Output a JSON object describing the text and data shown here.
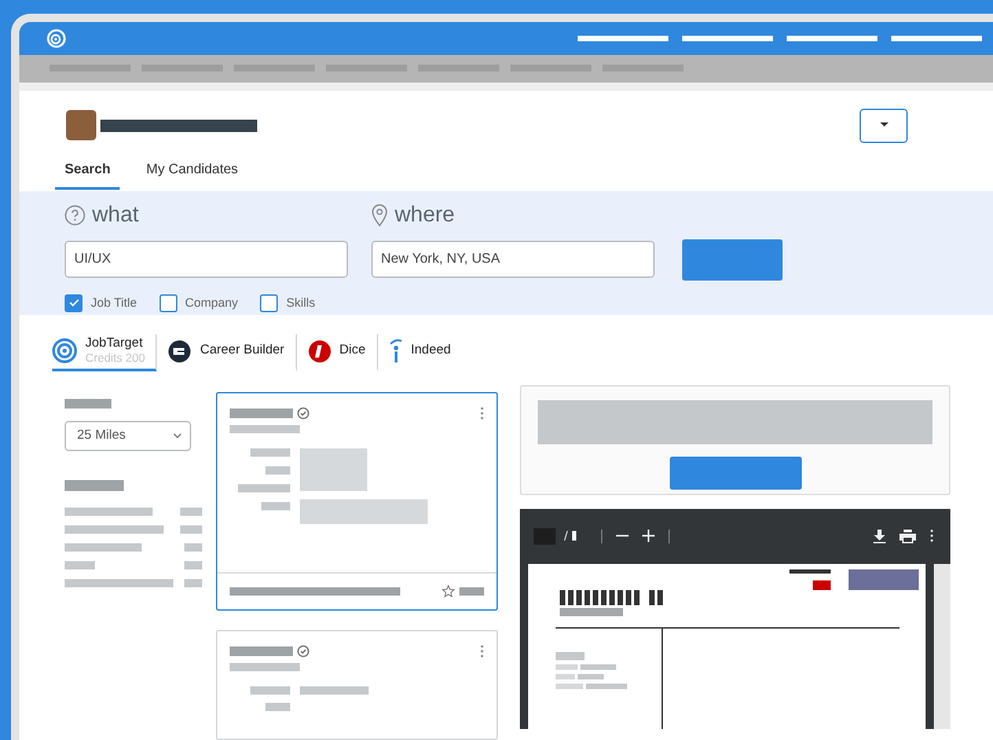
{
  "tabs": [
    {
      "label": "Search",
      "selected": true
    },
    {
      "label": "My Candidates",
      "selected": false
    }
  ],
  "search": {
    "what_label": "what",
    "where_label": "where",
    "what_value": "UI/UX",
    "where_value": "New York, NY, USA",
    "filters": [
      {
        "label": "Job Title",
        "checked": true
      },
      {
        "label": "Company",
        "checked": false
      },
      {
        "label": "Skills",
        "checked": false
      }
    ]
  },
  "sources": [
    {
      "kind": "jobtarget",
      "label": "JobTarget",
      "note": "Credits 200",
      "selected": true
    },
    {
      "kind": "careerbuilder",
      "label": "Career Builder",
      "selected": false
    },
    {
      "kind": "dice",
      "label": "Dice",
      "selected": false
    },
    {
      "kind": "indeed",
      "label": "Indeed",
      "selected": false
    }
  ],
  "distance": {
    "value": "25 Miles"
  }
}
